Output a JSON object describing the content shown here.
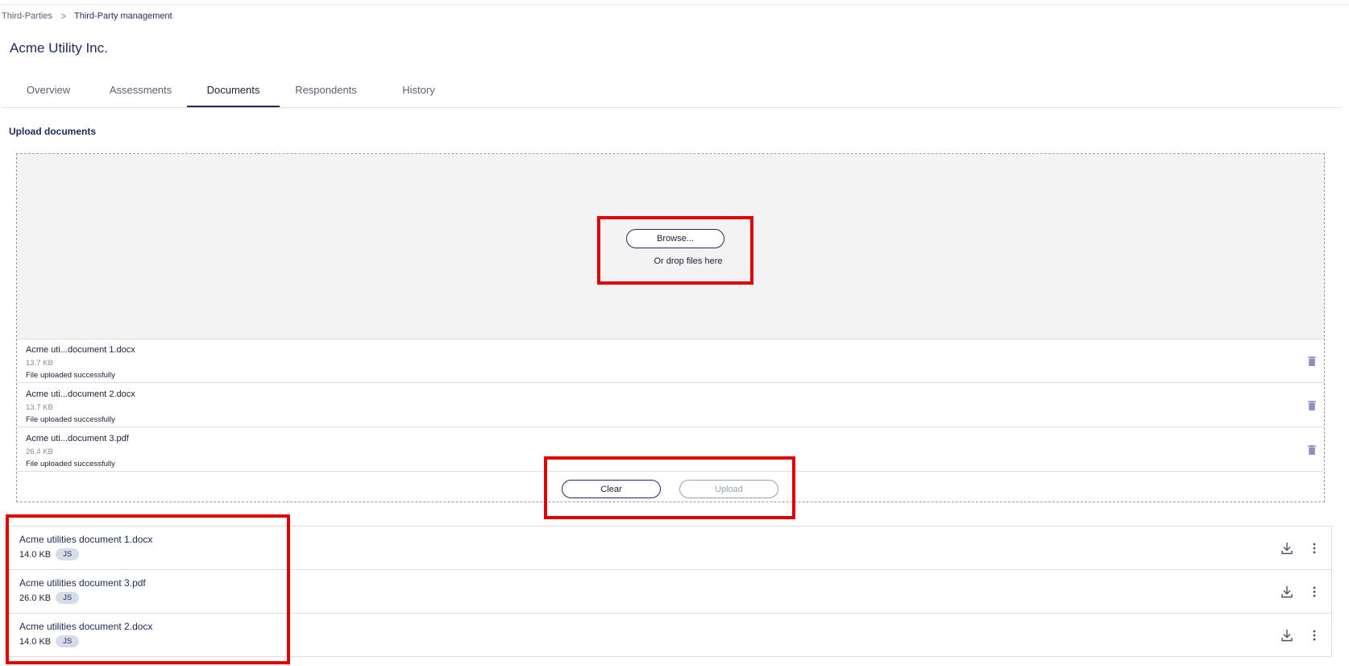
{
  "breadcrumb": {
    "parent": "Third-Parties",
    "separator": ">",
    "current": "Third-Party management"
  },
  "page": {
    "title": "Acme Utility Inc."
  },
  "tabs": [
    {
      "label": "Overview"
    },
    {
      "label": "Assessments"
    },
    {
      "label": "Documents",
      "active": true
    },
    {
      "label": "Respondents"
    },
    {
      "label": "History"
    }
  ],
  "upload": {
    "section_title": "Upload documents",
    "browse_label": "Browse...",
    "drop_hint": "Or drop files here",
    "queue": [
      {
        "name": "Acme uti...document 1.docx",
        "size": "13.7 KB",
        "status": "File uploaded successfully",
        "icon": "trash-icon"
      },
      {
        "name": "Acme uti...document 2.docx",
        "size": "13.7 KB",
        "status": "File uploaded successfully",
        "icon": "trash-icon"
      },
      {
        "name": "Acme uti...document 3.pdf",
        "size": "26.4 KB",
        "status": "File uploaded successfully",
        "icon": "trash-icon"
      }
    ],
    "clear_label": "Clear",
    "upload_label": "Upload"
  },
  "documents": [
    {
      "name": "Acme utilities document 1.docx",
      "size": "14.0 KB",
      "owner": "JS"
    },
    {
      "name": "Acme utilities document 3.pdf",
      "size": "26.0 KB",
      "owner": "JS"
    },
    {
      "name": "Acme utilities document 2.docx",
      "size": "14.0 KB",
      "owner": "JS"
    }
  ],
  "icons": {
    "download": "download-icon",
    "more": "more-vertical-icon",
    "trash": "trash-icon",
    "chevron": "chevron-right-icon"
  },
  "colors": {
    "primary": "#1f2a5a",
    "highlight": "#e00000",
    "trash": "#8b8fc4",
    "badge_bg": "#d6dde8"
  }
}
